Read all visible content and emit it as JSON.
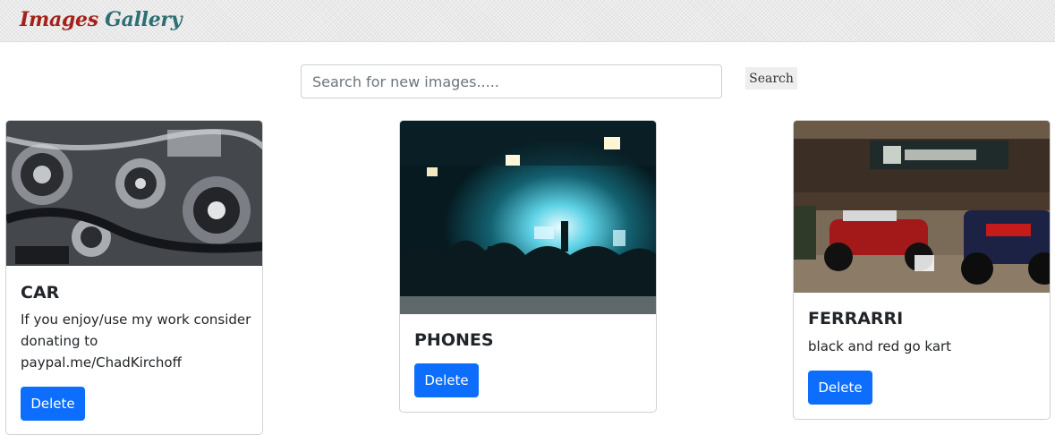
{
  "header": {
    "brand_part1": "Images",
    "brand_part2": "Gallery",
    "brand_color1": "#a3231b",
    "brand_color2": "#2f6f73"
  },
  "search": {
    "placeholder": "Search for new images.....",
    "value": "",
    "button_label": "Search"
  },
  "cards": [
    {
      "title": "CAR",
      "description": "If you enjoy/use my work consider donating to paypal.me/ChadKirchoff",
      "image_alt": "car engine close-up",
      "delete_label": "Delete"
    },
    {
      "title": "PHONES",
      "description": "",
      "image_alt": "concert crowd holding phones",
      "delete_label": "Delete"
    },
    {
      "title": "FERRARRI",
      "description": "black and red go kart",
      "image_alt": "formula one cars in showroom",
      "delete_label": "Delete"
    }
  ],
  "colors": {
    "primary": "#0d6efd",
    "navbar_bg": "#e9e9e9"
  }
}
